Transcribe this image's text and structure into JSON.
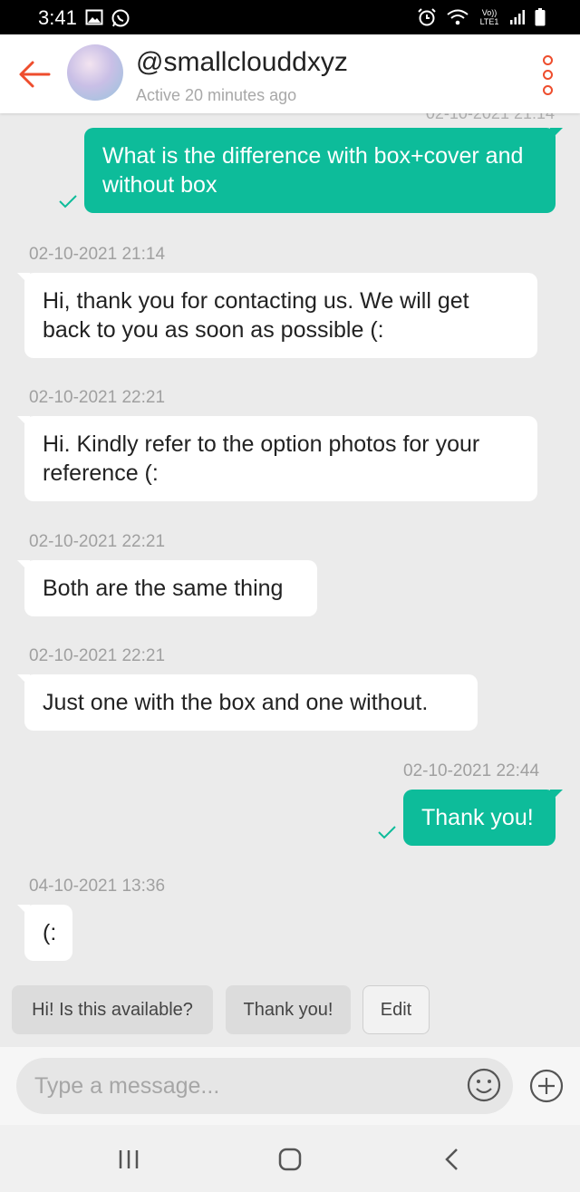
{
  "status_bar": {
    "time": "3:41",
    "left_icons": [
      "image-icon",
      "whatsapp-icon"
    ],
    "right_icons": [
      "alarm-icon",
      "wifi-icon",
      "volte-icon",
      "signal-icon",
      "battery-icon"
    ],
    "volte_text": "Vo))",
    "lte_text": "LTE1"
  },
  "header": {
    "contact_name": "@smallclouddxyz",
    "contact_status": "Active 20 minutes ago",
    "accent_color": "#ee4d2d"
  },
  "messages": [
    {
      "direction": "out",
      "text": "What is the difference with box+cover and without box",
      "timestamp": "02-10-2021 21:14",
      "read": true
    },
    {
      "direction": "in",
      "text": "Hi, thank you for contacting us. We will get back to you as soon as possible (:",
      "timestamp": "02-10-2021 21:14"
    },
    {
      "direction": "in",
      "text": "Hi. Kindly refer to the option photos for your reference (:",
      "timestamp": "02-10-2021 22:21"
    },
    {
      "direction": "in",
      "text": "Both are the same thing",
      "timestamp": "02-10-2021 22:21"
    },
    {
      "direction": "in",
      "text": "Just one with the box and one without.",
      "timestamp": "02-10-2021 22:21"
    },
    {
      "direction": "out",
      "text": "Thank you!",
      "timestamp": "02-10-2021 22:44",
      "read": true
    },
    {
      "direction": "in",
      "text": "(:",
      "timestamp": "04-10-2021 13:36"
    }
  ],
  "quick_replies": [
    {
      "label": "Hi! Is this available?"
    },
    {
      "label": "Thank you!"
    },
    {
      "label": "Edit"
    }
  ],
  "composer": {
    "placeholder": "Type a message..."
  },
  "colors": {
    "outgoing_bubble": "#0dbc9a",
    "incoming_bubble": "#ffffff",
    "background": "#ebebeb"
  }
}
